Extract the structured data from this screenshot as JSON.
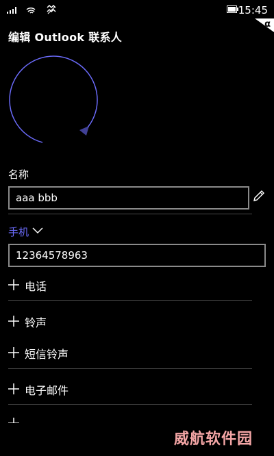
{
  "status_bar": {
    "time": "15:45",
    "icons": [
      "signal-icon",
      "wifi-icon",
      "vibrate-icon",
      "battery-icon"
    ]
  },
  "input_indicator": "α",
  "page": {
    "title": "编辑 Outlook 联系人"
  },
  "name_field": {
    "label": "名称",
    "value": "aaa bbb"
  },
  "phone_field": {
    "type_label": "手机",
    "value": "12364578963"
  },
  "add_items": [
    {
      "label": "电话"
    },
    {
      "label": "铃声"
    },
    {
      "label": "短信铃声"
    },
    {
      "label": "电子邮件"
    }
  ],
  "watermark": "威航软件园",
  "colors": {
    "accent": "#6a6af8",
    "background": "#000000",
    "border": "#8a8a8a",
    "watermark": "#f4a6a6"
  }
}
